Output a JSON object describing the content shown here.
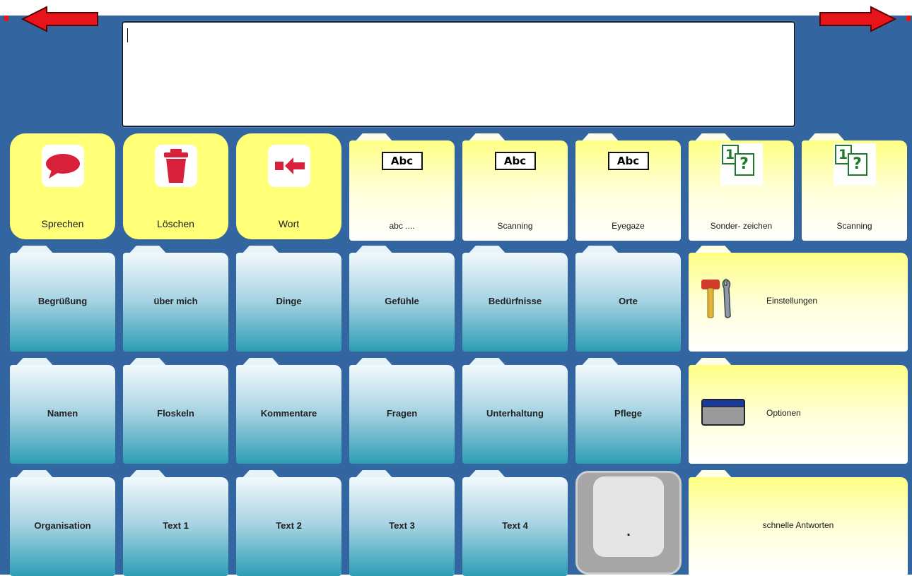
{
  "message": {
    "text": ""
  },
  "nav": {
    "back_color": "#e8141c",
    "forward_color": "#e8141c"
  },
  "actions": [
    {
      "label": "Sprechen",
      "icon": "speech-bubble-icon"
    },
    {
      "label": "Löschen",
      "icon": "trash-icon"
    },
    {
      "label": "Wort",
      "icon": "delete-word-icon"
    }
  ],
  "keyboards": [
    {
      "label": "abc ....",
      "icon_text": "Abc"
    },
    {
      "label": "Scanning",
      "icon_text": "Abc"
    },
    {
      "label": "Eyegaze",
      "icon_text": "Abc"
    }
  ],
  "symbols": [
    {
      "label": "Sonder- zeichen",
      "n": "1",
      "q": "?"
    },
    {
      "label": "Scanning",
      "n": "1",
      "q": "?"
    }
  ],
  "topics_row1": [
    "Begrüßung",
    "über mich",
    "Dinge",
    "Gefühle",
    "Bedürfnisse",
    "Orte"
  ],
  "topics_row2": [
    "Namen",
    "Floskeln",
    "Kommentare",
    "Fragen",
    "Unterhaltung",
    "Pflege"
  ],
  "topics_row3": [
    "Organisation",
    "Text 1",
    "Text 2",
    "Text 3",
    "Text 4"
  ],
  "settings": {
    "label": "Einstellungen",
    "icon": "tools-icon"
  },
  "options": {
    "label": "Optionen",
    "icon": "window-icon"
  },
  "period_key": {
    "label": "."
  },
  "quick": {
    "label": "schnelle Antworten"
  },
  "colors": {
    "board": "#3366a0",
    "action_yellow": "#ffff78",
    "folder_teal": "#2c9eb5"
  }
}
